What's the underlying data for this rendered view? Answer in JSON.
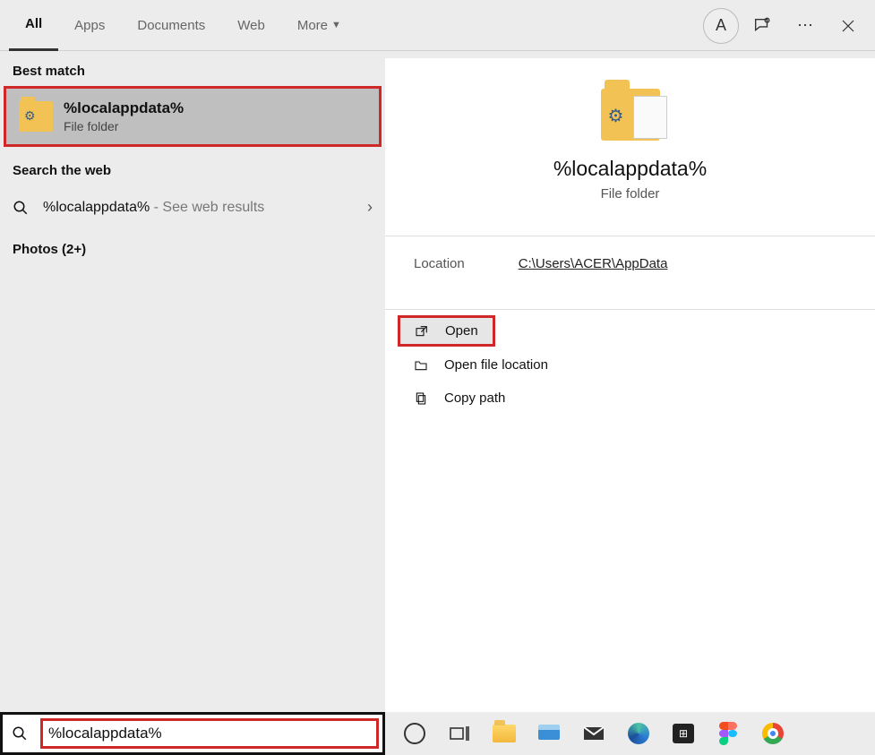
{
  "tabs": {
    "all": "All",
    "apps": "Apps",
    "documents": "Documents",
    "web": "Web",
    "more": "More"
  },
  "avatar_initial": "A",
  "left": {
    "best_match_label": "Best match",
    "result_title": "%localappdata%",
    "result_sub": "File folder",
    "search_web_label": "Search the web",
    "web_query": "%localappdata%",
    "web_suffix": " - See web results",
    "photos_label": "Photos (2+)"
  },
  "right": {
    "title": "%localappdata%",
    "sub": "File folder",
    "location_label": "Location",
    "location_path": "C:\\Users\\ACER\\AppData",
    "actions": {
      "open": "Open",
      "open_location": "Open file location",
      "copy_path": "Copy path"
    }
  },
  "search_value": "%localappdata%"
}
